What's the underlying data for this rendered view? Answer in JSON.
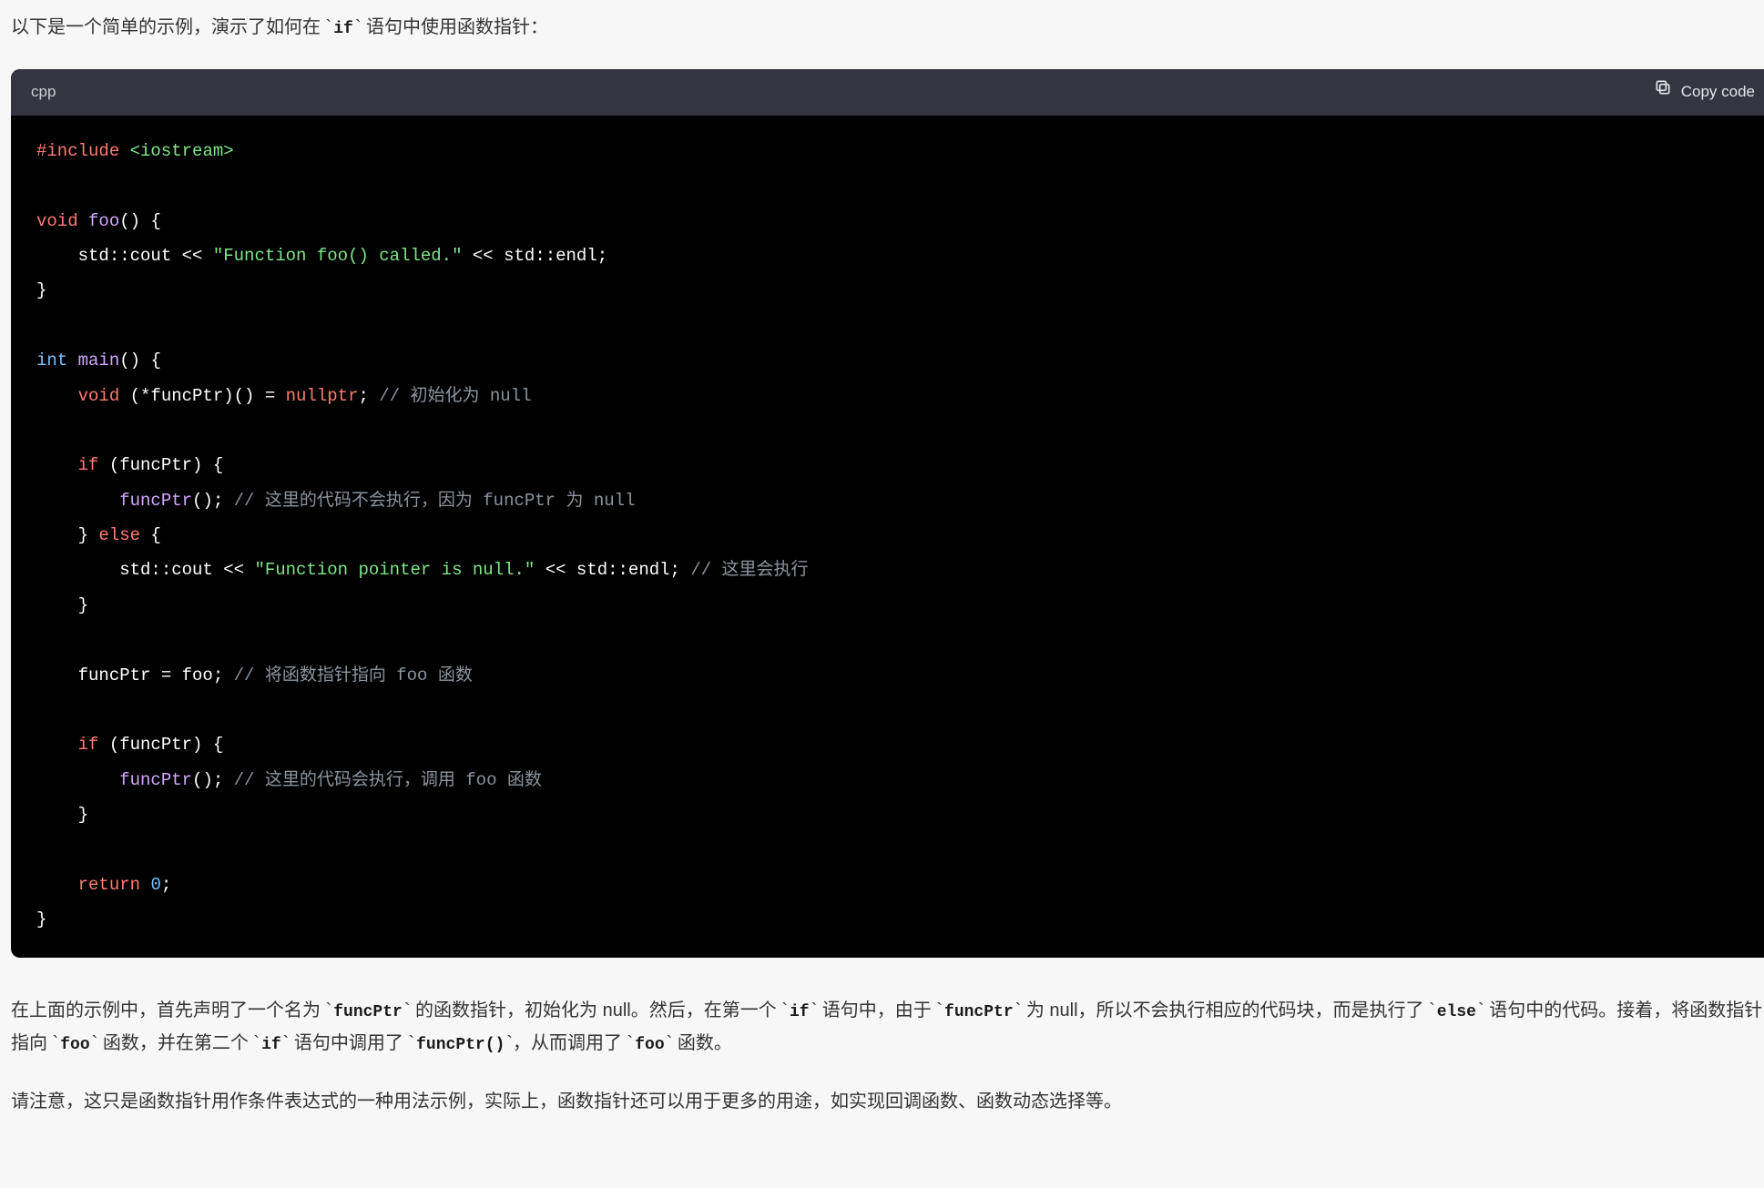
{
  "intro": {
    "before_if": "以下是一个简单的示例，演示了如何在 `",
    "if_token": "if",
    "after_if": "` 语句中使用函数指针："
  },
  "codeblock": {
    "lang": "cpp",
    "copy_label": "Copy code",
    "tokens": {
      "include": "#include",
      "iostream": "<iostream>",
      "void": "void",
      "foo": "foo",
      "main": "main",
      "int": "int",
      "funcPtr": "funcPtr",
      "nullptr": "nullptr",
      "if": "if",
      "else": "else",
      "return": "return",
      "zero": "0",
      "str_foo_called": "\"Function foo() called.\"",
      "str_ptr_null": "\"Function pointer is null.\"",
      "cmt_init_null": "// 初始化为 null",
      "cmt_noexec": "// 这里的代码不会执行，因为 funcPtr 为 null",
      "cmt_will_exec": "// 这里会执行",
      "cmt_point_foo": "// 将函数指针指向 foo 函数",
      "cmt_call_foo": "// 这里的代码会执行，调用 foo 函数"
    }
  },
  "outro": {
    "p1_frag1": "在上面的示例中，首先声明了一个名为 `",
    "p1_funcPtr": "funcPtr",
    "p1_frag2": "` 的函数指针，初始化为 null。然后，在第一个 `",
    "p1_if1": "if",
    "p1_frag3": "` 语句中，由于 `",
    "p1_funcPtr2": "funcPtr",
    "p1_frag4": "` 为 null，所以不会执行相应的代码块，而是执行了 `",
    "p1_else": "else",
    "p1_frag5": "` 语句中的代码。接着，将函数指针指向 `",
    "p1_foo": "foo",
    "p1_frag6": "` 函数，并在第二个 `",
    "p1_if2": "if",
    "p1_frag7": "` 语句中调用了 `",
    "p1_funcPtrCall": "funcPtr()",
    "p1_frag8": "`，从而调用了 `",
    "p1_foo2": "foo",
    "p1_frag9": "` 函数。",
    "p2": "请注意，这只是函数指针用作条件表达式的一种用法示例，实际上，函数指针还可以用于更多的用途，如实现回调函数、函数动态选择等。"
  }
}
